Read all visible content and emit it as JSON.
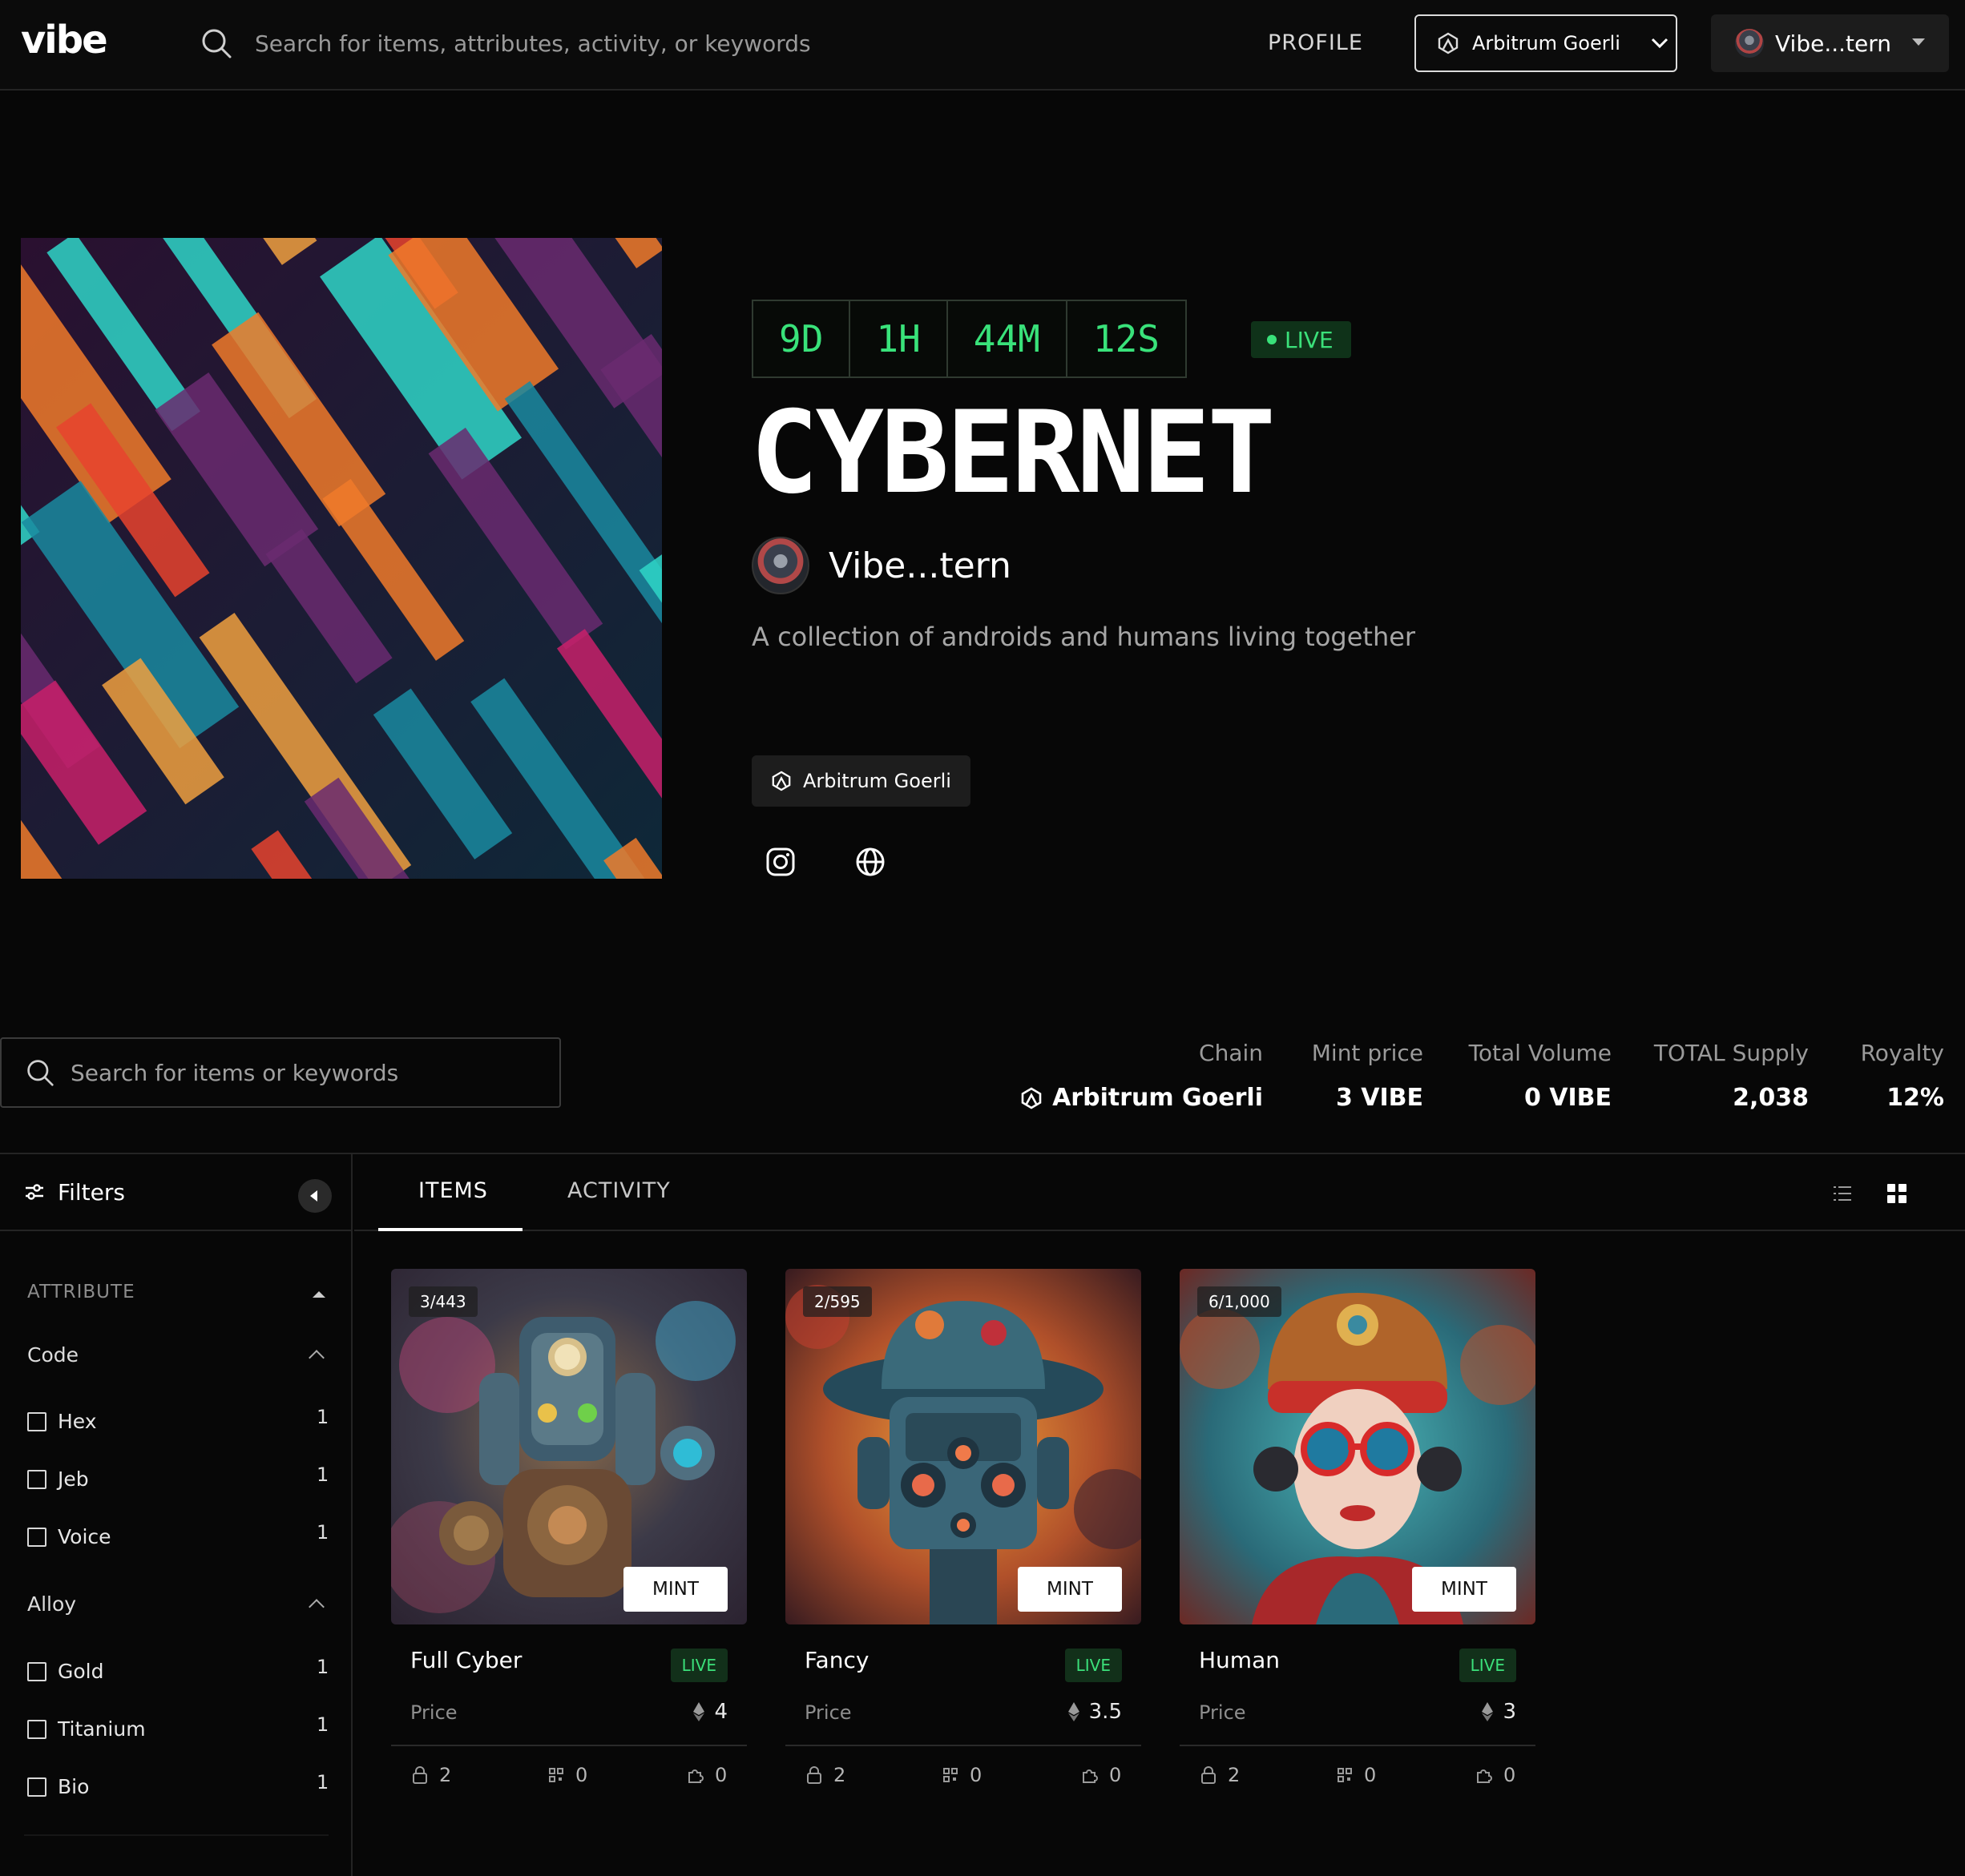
{
  "app": {
    "logo": "vibe"
  },
  "topbar": {
    "search_placeholder": "Search for items, attributes, activity, or keywords",
    "profile_link": "PROFILE",
    "network": "Arbitrum Goerli",
    "account": "Vibe...tern"
  },
  "hero": {
    "countdown": [
      "9D",
      "1H",
      "44M",
      "12S"
    ],
    "status": "LIVE",
    "title": "CYBERNET",
    "creator": "Vibe...tern",
    "description": "A collection of androids and humans living together",
    "chain_pill": "Arbitrum Goerli",
    "social_icons": [
      "instagram-icon",
      "globe-icon"
    ]
  },
  "items_search": {
    "placeholder": "Search for items or keywords"
  },
  "stats": [
    {
      "label": "Chain",
      "value": "Arbitrum Goerli"
    },
    {
      "label": "Mint price",
      "value": "3 VIBE"
    },
    {
      "label": "Total Volume",
      "value": "0 VIBE"
    },
    {
      "label": "TOTAL Supply",
      "value": "2,038"
    },
    {
      "label": "Royalty",
      "value": "12%"
    }
  ],
  "sidebar": {
    "title": "Filters",
    "section": "ATTRIBUTE",
    "groups": [
      {
        "name": "Code",
        "options": [
          {
            "label": "Hex",
            "count": "1"
          },
          {
            "label": "Jeb",
            "count": "1"
          },
          {
            "label": "Voice",
            "count": "1"
          }
        ]
      },
      {
        "name": "Alloy",
        "options": [
          {
            "label": "Gold",
            "count": "1"
          },
          {
            "label": "Titanium",
            "count": "1"
          },
          {
            "label": "Bio",
            "count": "1"
          }
        ]
      }
    ]
  },
  "tabs": [
    {
      "label": "ITEMS",
      "active": true
    },
    {
      "label": "ACTIVITY",
      "active": false
    }
  ],
  "cards": [
    {
      "edition": "3/443",
      "name": "Full Cyber",
      "status": "LIVE",
      "price_label": "Price",
      "price": "4",
      "mint_label": "MINT",
      "stats": [
        "2",
        "0",
        "0"
      ]
    },
    {
      "edition": "2/595",
      "name": "Fancy",
      "status": "LIVE",
      "price_label": "Price",
      "price": "3.5",
      "mint_label": "MINT",
      "stats": [
        "2",
        "0",
        "0"
      ]
    },
    {
      "edition": "6/1,000",
      "name": "Human",
      "status": "LIVE",
      "price_label": "Price",
      "price": "3",
      "mint_label": "MINT",
      "stats": [
        "2",
        "0",
        "0"
      ]
    }
  ],
  "colors": {
    "accent_green": "#39e27a",
    "background": "#070707",
    "live_bg": "#0f3219"
  }
}
